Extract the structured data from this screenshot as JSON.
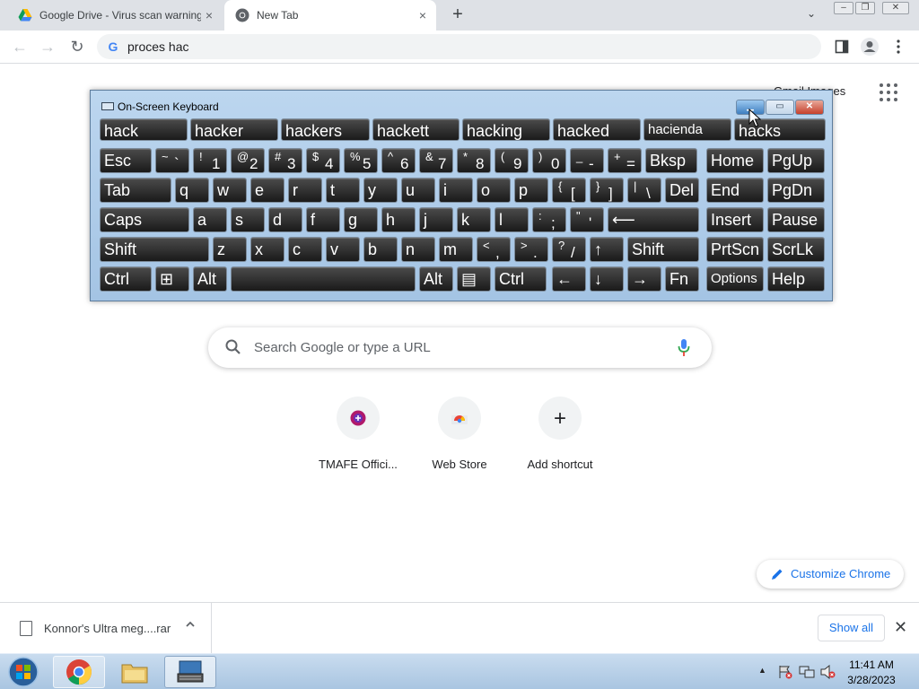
{
  "browser": {
    "tabs": [
      {
        "label": "Google Drive - Virus scan warning",
        "close": "×"
      },
      {
        "label": "New Tab",
        "close": "×"
      }
    ],
    "new_tab_symbol": "+",
    "tab_search_symbol": "⌄",
    "omnibox": {
      "value": "proces hac"
    },
    "nav": {
      "back": "←",
      "forward": "→",
      "reload": "↻"
    }
  },
  "ntp": {
    "gmail_images": "Gmail  Images",
    "search_placeholder": "Search Google or type a URL",
    "shortcuts": [
      {
        "label": "TMAFE Offici..."
      },
      {
        "label": "Web Store"
      },
      {
        "label": "Add shortcut",
        "symbol": "+"
      }
    ],
    "customize_label": "Customize Chrome"
  },
  "download_shelf": {
    "file_name": "Konnor's Ultra meg....rar",
    "show_all": "Show all",
    "close": "✕"
  },
  "osk": {
    "title": "On-Screen Keyboard",
    "controls": {
      "min": "▁",
      "max": "▭",
      "close": "✕"
    },
    "suggestions": [
      "hack",
      "hacker",
      "hackers",
      "hackett",
      "hacking",
      "hacked",
      "hacienda",
      "hacks"
    ],
    "rows": [
      [
        {
          "l": "Esc"
        },
        {
          "s": "~",
          "b": "`"
        },
        {
          "s": "!",
          "b": "1"
        },
        {
          "s": "@",
          "b": "2"
        },
        {
          "s": "#",
          "b": "3"
        },
        {
          "s": "$",
          "b": "4"
        },
        {
          "s": "%",
          "b": "5"
        },
        {
          "s": "^",
          "b": "6"
        },
        {
          "s": "&",
          "b": "7"
        },
        {
          "s": "*",
          "b": "8"
        },
        {
          "s": "(",
          "b": "9"
        },
        {
          "s": ")",
          "b": "0"
        },
        {
          "s": "_",
          "b": "-"
        },
        {
          "s": "+",
          "b": "="
        },
        {
          "l": "Bksp"
        },
        {
          "l": "Home"
        },
        {
          "l": "PgUp"
        }
      ],
      [
        {
          "l": "Tab"
        },
        {
          "l": "q"
        },
        {
          "l": "w"
        },
        {
          "l": "e"
        },
        {
          "l": "r"
        },
        {
          "l": "t"
        },
        {
          "l": "y"
        },
        {
          "l": "u"
        },
        {
          "l": "i"
        },
        {
          "l": "o"
        },
        {
          "l": "p"
        },
        {
          "s": "{",
          "b": "["
        },
        {
          "s": "}",
          "b": "]"
        },
        {
          "s": "|",
          "b": "\\"
        },
        {
          "l": "Del"
        },
        {
          "l": "End"
        },
        {
          "l": "PgDn"
        }
      ],
      [
        {
          "l": "Caps"
        },
        {
          "l": "a"
        },
        {
          "l": "s"
        },
        {
          "l": "d"
        },
        {
          "l": "f"
        },
        {
          "l": "g"
        },
        {
          "l": "h"
        },
        {
          "l": "j"
        },
        {
          "l": "k"
        },
        {
          "l": "l"
        },
        {
          "s": ":",
          "b": ";"
        },
        {
          "s": "\"",
          "b": "'"
        },
        {
          "l": "⟵"
        },
        {
          "l": "Insert"
        },
        {
          "l": "Pause"
        }
      ],
      [
        {
          "l": "Shift"
        },
        {
          "l": "z"
        },
        {
          "l": "x"
        },
        {
          "l": "c"
        },
        {
          "l": "v"
        },
        {
          "l": "b"
        },
        {
          "l": "n"
        },
        {
          "l": "m"
        },
        {
          "s": "<",
          "b": ","
        },
        {
          "s": ">",
          "b": "."
        },
        {
          "s": "?",
          "b": "/"
        },
        {
          "l": "↑"
        },
        {
          "l": "Shift"
        },
        {
          "l": "PrtScn"
        },
        {
          "l": "ScrLk"
        }
      ],
      [
        {
          "l": "Ctrl"
        },
        {
          "l": "⊞"
        },
        {
          "l": "Alt"
        },
        {
          "l": ""
        },
        {
          "l": "Alt"
        },
        {
          "l": "▤"
        },
        {
          "l": "Ctrl"
        },
        {
          "l": "←"
        },
        {
          "l": "↓"
        },
        {
          "l": "→"
        },
        {
          "l": "Fn"
        },
        {
          "l": "Options"
        },
        {
          "l": "Help"
        }
      ]
    ]
  },
  "taskbar": {
    "clock_time": "11:41 AM",
    "clock_date": "3/28/2023",
    "tray_arrow": "▲"
  },
  "colors": {
    "accent": "#1a73e8",
    "taskbar": "#b9d1ea",
    "osk_frame": "#a4c4e4"
  }
}
